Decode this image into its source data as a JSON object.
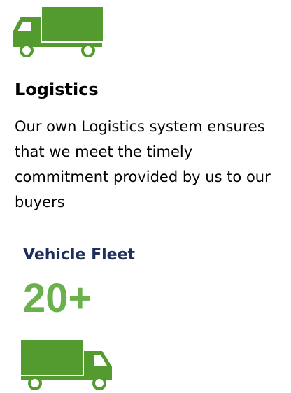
{
  "title": "Logistics",
  "description": "Our own Logistics system ensures that we meet the timely commitment provided by us to our buyers",
  "fleet": {
    "label": "Vehicle Fleet",
    "count": "20+"
  },
  "icons": {
    "top": "truck-icon",
    "bottom": "truck-icon"
  },
  "colors": {
    "truck_green": "#549b2f",
    "count_green": "#6ab04c",
    "label_navy": "#1f2e5a",
    "text": "#000000"
  }
}
